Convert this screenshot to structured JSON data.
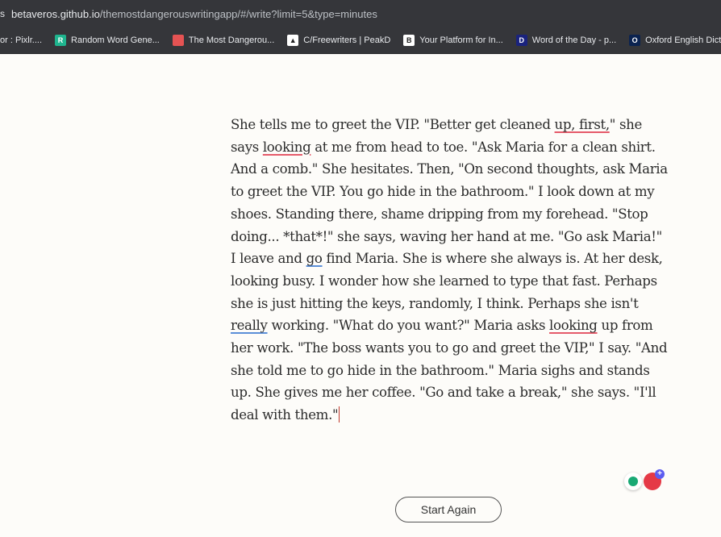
{
  "browser": {
    "url_host": "betaveros.github.io",
    "url_path": "/themostdangerouswritingapp/#/write?limit=5&type=minutes",
    "lock_glyph": "s"
  },
  "bookmarks": [
    {
      "label": "tor : Pixlr....",
      "fav": "",
      "color": "#35363a"
    },
    {
      "label": "Random Word Gene...",
      "fav": "R",
      "color": "#1fb58f"
    },
    {
      "label": "The Most Dangerou...",
      "fav": "",
      "color": "#e55353"
    },
    {
      "label": "C/Freewriters | PeakD",
      "fav": "▲",
      "color": "#ffffff"
    },
    {
      "label": "Your Platform for In...",
      "fav": "B",
      "color": "#ffffff"
    },
    {
      "label": "Word of the Day - p...",
      "fav": "D",
      "color": "#1a237e"
    },
    {
      "label": "Oxford English Dicti...",
      "fav": "O",
      "color": "#0b2350"
    }
  ],
  "writing": {
    "segments": [
      {
        "t": "She tells me to greet the VIP. \"Better get cleaned "
      },
      {
        "t": "up, first,",
        "u": "red"
      },
      {
        "t": "\" she says "
      },
      {
        "t": "looking",
        "u": "red"
      },
      {
        "t": " at me from head to toe. \"Ask Maria for a clean shirt. And a comb.\" She hesitates. Then, \"On second thoughts, ask Maria to greet the VIP. You go hide in the bathroom.\" I look down at my shoes. Standing there, shame dripping from my forehead. \"Stop doing... *that*!\" she says, waving her hand at me. \"Go ask Maria!\" I leave and "
      },
      {
        "t": "go",
        "u": "blue"
      },
      {
        "t": " find Maria. She is where she always is. At her desk, looking busy. I wonder how she learned to type that fast. Perhaps she is just hitting the keys, randomly, I think. Perhaps she isn't "
      },
      {
        "t": "really",
        "u": "blue"
      },
      {
        "t": " working. \"What do you want?\" Maria asks "
      },
      {
        "t": "looking",
        "u": "red"
      },
      {
        "t": " up from her work. \"The boss wants you to go and greet the VIP,\" I say. \"And she told me to go hide in the bathroom.\" Maria sighs and stands up. She gives me her coffee. \"Go and take a break,\" she says. \"I'll deal with them.\""
      }
    ]
  },
  "grammar_widget": {
    "badge": "+",
    "colors": {
      "bulb": "#19a974",
      "main": "#e53946",
      "badge": "#5c5cf0"
    }
  },
  "actions": {
    "start_again_label": "Start Again"
  }
}
